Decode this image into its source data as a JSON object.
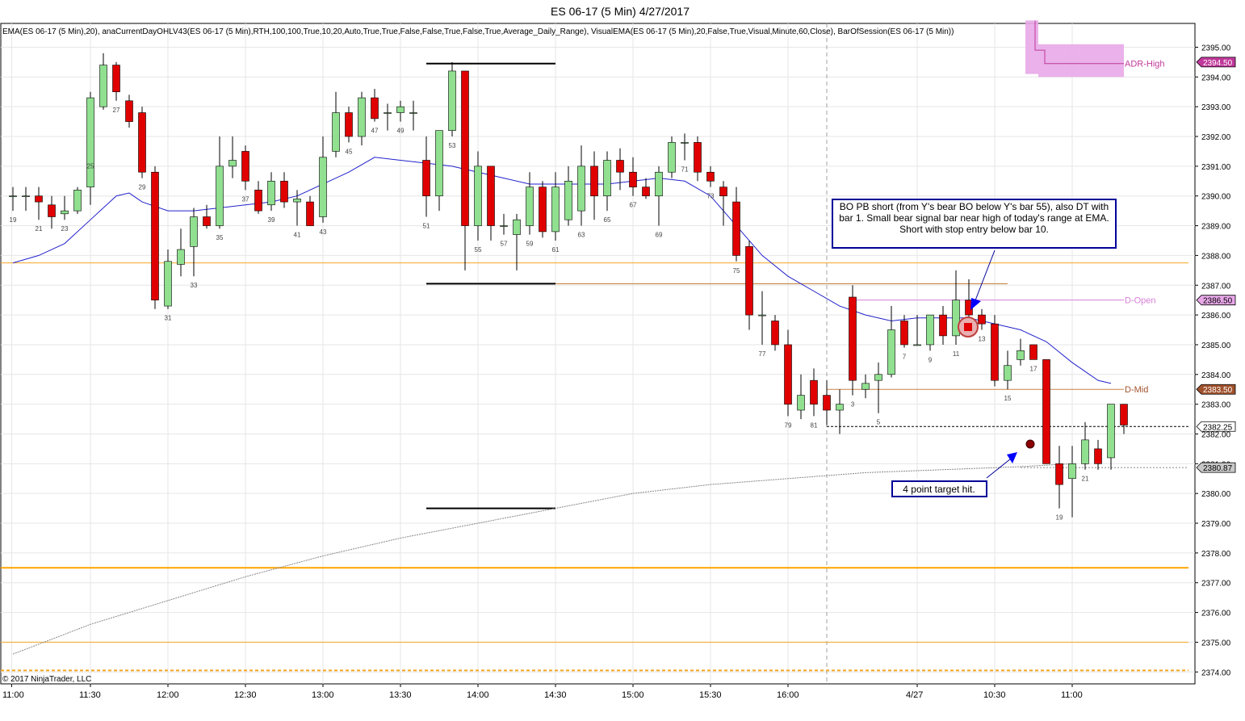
{
  "chart_data": {
    "type": "candlestick",
    "title": "ES 06-17 (5 Min)  4/27/2017",
    "indicator_label": "EMA(ES 06-17 (5 Min),20), anaCurrentDayOHLV43(ES 06-17 (5 Min),RTH,100,100,True,10,20,Auto,True,True,False,False,True,False,True,Average_Daily_Range), VisualEMA(ES 06-17 (5 Min),20,False,True,Visual,Minute,60,Close), BarOfSession(ES 06-17 (5 Min))",
    "copyright": "© 2017 NinjaTrader, LLC",
    "ylim": [
      2373.6,
      2395.8
    ],
    "y_ticks": [
      "2395.00",
      "2394.00",
      "2393.00",
      "2392.00",
      "2391.00",
      "2390.00",
      "2389.00",
      "2388.00",
      "2387.00",
      "2386.00",
      "2385.00",
      "2384.00",
      "2383.00",
      "2382.00",
      "2381.00",
      "2380.00",
      "2379.00",
      "2378.00",
      "2377.00",
      "2376.00",
      "2375.00",
      "2374.00"
    ],
    "x_ticks": [
      {
        "bar": -0.1,
        "label": "11:00"
      },
      {
        "bar": 6,
        "label": "11:30"
      },
      {
        "bar": 12,
        "label": "12:00"
      },
      {
        "bar": 18,
        "label": "12:30"
      },
      {
        "bar": 24,
        "label": "13:00"
      },
      {
        "bar": 30,
        "label": "13:30"
      },
      {
        "bar": 36,
        "label": "14:00"
      },
      {
        "bar": 42,
        "label": "14:30"
      },
      {
        "bar": 48,
        "label": "15:00"
      },
      {
        "bar": 54,
        "label": "15:30"
      },
      {
        "bar": 60,
        "label": "16:00"
      },
      {
        "bar": 70,
        "label": "4/27"
      },
      {
        "bar": 76,
        "label": "10:30"
      },
      {
        "bar": 82,
        "label": "11:00"
      }
    ],
    "session_break_bar": 63,
    "bars": [
      {
        "o": 2390.0,
        "h": 2390.3,
        "l": 2389.5,
        "c": 2390.0
      },
      {
        "o": 2390.0,
        "h": 2390.3,
        "l": 2389.5,
        "c": 2390.0
      },
      {
        "o": 2390.0,
        "h": 2390.3,
        "l": 2389.2,
        "c": 2389.8
      },
      {
        "o": 2389.7,
        "h": 2390.0,
        "l": 2388.9,
        "c": 2389.3
      },
      {
        "o": 2389.4,
        "h": 2390.0,
        "l": 2389.2,
        "c": 2389.5
      },
      {
        "o": 2389.5,
        "h": 2390.3,
        "l": 2389.4,
        "c": 2390.2
      },
      {
        "o": 2390.3,
        "h": 2393.5,
        "l": 2389.7,
        "c": 2393.3
      },
      {
        "o": 2393.0,
        "h": 2394.8,
        "l": 2392.9,
        "c": 2394.4
      },
      {
        "o": 2394.4,
        "h": 2394.5,
        "l": 2393.2,
        "c": 2393.5
      },
      {
        "o": 2393.2,
        "h": 2393.4,
        "l": 2392.3,
        "c": 2392.5
      },
      {
        "o": 2392.8,
        "h": 2393.0,
        "l": 2390.6,
        "c": 2390.8
      },
      {
        "o": 2390.8,
        "h": 2391.0,
        "l": 2386.2,
        "c": 2386.5
      },
      {
        "o": 2386.3,
        "h": 2388.2,
        "l": 2386.2,
        "c": 2387.8
      },
      {
        "o": 2387.7,
        "h": 2388.9,
        "l": 2387.3,
        "c": 2388.2
      },
      {
        "o": 2388.3,
        "h": 2389.6,
        "l": 2387.3,
        "c": 2389.3
      },
      {
        "o": 2389.3,
        "h": 2389.7,
        "l": 2388.9,
        "c": 2389.0
      },
      {
        "o": 2389.0,
        "h": 2392.0,
        "l": 2388.9,
        "c": 2391.0
      },
      {
        "o": 2391.0,
        "h": 2392.0,
        "l": 2390.6,
        "c": 2391.2
      },
      {
        "o": 2391.5,
        "h": 2391.7,
        "l": 2390.2,
        "c": 2390.5
      },
      {
        "o": 2390.2,
        "h": 2390.5,
        "l": 2389.4,
        "c": 2389.5
      },
      {
        "o": 2389.7,
        "h": 2390.8,
        "l": 2389.5,
        "c": 2390.5
      },
      {
        "o": 2390.5,
        "h": 2390.8,
        "l": 2389.6,
        "c": 2389.8
      },
      {
        "o": 2389.8,
        "h": 2390.2,
        "l": 2389.0,
        "c": 2389.9
      },
      {
        "o": 2389.8,
        "h": 2390.0,
        "l": 2389.0,
        "c": 2389.0
      },
      {
        "o": 2389.3,
        "h": 2392.0,
        "l": 2389.1,
        "c": 2391.3
      },
      {
        "o": 2391.5,
        "h": 2393.5,
        "l": 2391.3,
        "c": 2392.8
      },
      {
        "o": 2392.8,
        "h": 2393.0,
        "l": 2391.8,
        "c": 2392.0
      },
      {
        "o": 2392.0,
        "h": 2393.5,
        "l": 2391.7,
        "c": 2393.3
      },
      {
        "o": 2393.3,
        "h": 2393.6,
        "l": 2392.5,
        "c": 2392.6
      },
      {
        "o": 2392.8,
        "h": 2393.1,
        "l": 2392.2,
        "c": 2392.8
      },
      {
        "o": 2392.8,
        "h": 2393.2,
        "l": 2392.5,
        "c": 2393.0
      },
      {
        "o": 2392.8,
        "h": 2393.2,
        "l": 2392.2,
        "c": 2392.8
      },
      {
        "o": 2391.2,
        "h": 2392.0,
        "l": 2389.3,
        "c": 2390.0
      },
      {
        "o": 2390.0,
        "h": 2392.0,
        "l": 2389.5,
        "c": 2392.2
      },
      {
        "o": 2392.2,
        "h": 2394.5,
        "l": 2392.0,
        "c": 2394.2
      },
      {
        "o": 2394.2,
        "h": 2394.2,
        "l": 2387.5,
        "c": 2389.0
      },
      {
        "o": 2389.0,
        "h": 2391.5,
        "l": 2388.5,
        "c": 2391.0
      },
      {
        "o": 2391.0,
        "h": 2391.0,
        "l": 2388.5,
        "c": 2389.0
      },
      {
        "o": 2389.0,
        "h": 2389.4,
        "l": 2388.7,
        "c": 2389.0
      },
      {
        "o": 2388.7,
        "h": 2389.4,
        "l": 2387.5,
        "c": 2389.2
      },
      {
        "o": 2389.0,
        "h": 2390.8,
        "l": 2388.7,
        "c": 2390.3
      },
      {
        "o": 2390.3,
        "h": 2390.5,
        "l": 2388.6,
        "c": 2388.8
      },
      {
        "o": 2388.8,
        "h": 2390.8,
        "l": 2388.5,
        "c": 2390.3
      },
      {
        "o": 2389.2,
        "h": 2391.0,
        "l": 2389.0,
        "c": 2390.5
      },
      {
        "o": 2389.5,
        "h": 2391.7,
        "l": 2389.0,
        "c": 2391.0
      },
      {
        "o": 2391.0,
        "h": 2391.5,
        "l": 2389.2,
        "c": 2390.0
      },
      {
        "o": 2390.0,
        "h": 2391.5,
        "l": 2389.5,
        "c": 2391.2
      },
      {
        "o": 2391.2,
        "h": 2391.6,
        "l": 2390.2,
        "c": 2390.8
      },
      {
        "o": 2390.8,
        "h": 2391.3,
        "l": 2390.0,
        "c": 2390.3
      },
      {
        "o": 2390.3,
        "h": 2390.6,
        "l": 2389.9,
        "c": 2390.0
      },
      {
        "o": 2390.0,
        "h": 2391.0,
        "l": 2389.0,
        "c": 2390.8
      },
      {
        "o": 2390.8,
        "h": 2392.0,
        "l": 2390.6,
        "c": 2391.8
      },
      {
        "o": 2391.8,
        "h": 2392.1,
        "l": 2391.2,
        "c": 2391.8
      },
      {
        "o": 2391.8,
        "h": 2392.0,
        "l": 2390.5,
        "c": 2390.8
      },
      {
        "o": 2390.8,
        "h": 2391.0,
        "l": 2390.3,
        "c": 2390.5
      },
      {
        "o": 2390.3,
        "h": 2390.5,
        "l": 2389.0,
        "c": 2390.0
      },
      {
        "o": 2389.8,
        "h": 2390.3,
        "l": 2387.8,
        "c": 2388.0
      },
      {
        "o": 2388.3,
        "h": 2388.5,
        "l": 2385.5,
        "c": 2386.0
      },
      {
        "o": 2386.0,
        "h": 2386.8,
        "l": 2385.0,
        "c": 2386.0
      },
      {
        "o": 2385.8,
        "h": 2386.0,
        "l": 2384.8,
        "c": 2385.0
      },
      {
        "o": 2385.0,
        "h": 2385.5,
        "l": 2382.6,
        "c": 2383.0
      },
      {
        "o": 2382.8,
        "h": 2384.0,
        "l": 2382.5,
        "c": 2383.3
      },
      {
        "o": 2383.8,
        "h": 2384.2,
        "l": 2382.6,
        "c": 2383.0
      },
      {
        "o": 2383.3,
        "h": 2383.8,
        "l": 2382.3,
        "c": 2382.8
      },
      {
        "o": 2382.8,
        "h": 2383.5,
        "l": 2382.0,
        "c": 2383.0
      },
      {
        "o": 2386.6,
        "h": 2387.0,
        "l": 2383.3,
        "c": 2383.8
      },
      {
        "o": 2383.5,
        "h": 2384.0,
        "l": 2383.2,
        "c": 2383.7
      },
      {
        "o": 2383.8,
        "h": 2384.4,
        "l": 2382.7,
        "c": 2384.0
      },
      {
        "o": 2384.0,
        "h": 2386.3,
        "l": 2383.9,
        "c": 2385.5
      },
      {
        "o": 2385.8,
        "h": 2386.0,
        "l": 2384.9,
        "c": 2385.0
      },
      {
        "o": 2385.0,
        "h": 2386.0,
        "l": 2385.0,
        "c": 2385.0
      },
      {
        "o": 2385.0,
        "h": 2386.0,
        "l": 2384.8,
        "c": 2386.0
      },
      {
        "o": 2386.0,
        "h": 2386.3,
        "l": 2385.0,
        "c": 2385.3
      },
      {
        "o": 2385.3,
        "h": 2387.5,
        "l": 2385.0,
        "c": 2386.5
      },
      {
        "o": 2386.5,
        "h": 2387.2,
        "l": 2385.8,
        "c": 2386.0
      },
      {
        "o": 2386.0,
        "h": 2386.2,
        "l": 2385.5,
        "c": 2385.7
      },
      {
        "o": 2385.7,
        "h": 2386.0,
        "l": 2383.6,
        "c": 2383.8
      },
      {
        "o": 2383.8,
        "h": 2384.8,
        "l": 2383.5,
        "c": 2384.3
      },
      {
        "o": 2384.5,
        "h": 2385.2,
        "l": 2384.3,
        "c": 2384.8
      },
      {
        "o": 2385.0,
        "h": 2385.0,
        "l": 2384.5,
        "c": 2384.5
      },
      {
        "o": 2384.5,
        "h": 2384.5,
        "l": 2381.0,
        "c": 2381.0
      },
      {
        "o": 2381.0,
        "h": 2381.6,
        "l": 2379.5,
        "c": 2380.3
      },
      {
        "o": 2380.5,
        "h": 2381.6,
        "l": 2379.2,
        "c": 2381.0
      },
      {
        "o": 2381.0,
        "h": 2382.4,
        "l": 2380.8,
        "c": 2381.8
      },
      {
        "o": 2381.5,
        "h": 2381.8,
        "l": 2380.8,
        "c": 2381.0
      },
      {
        "o": 2381.2,
        "h": 2383.0,
        "l": 2380.8,
        "c": 2383.0
      },
      {
        "o": 2383.0,
        "h": 2383.0,
        "l": 2382.0,
        "c": 2382.3
      }
    ],
    "bar_labels": [
      {
        "bar": 0,
        "text": "19",
        "at": "low"
      },
      {
        "bar": 2,
        "text": "21",
        "at": "low"
      },
      {
        "bar": 4,
        "text": "23",
        "at": "low"
      },
      {
        "bar": 6,
        "text": "25",
        "at": "high"
      },
      {
        "bar": 8,
        "text": "27",
        "at": "low"
      },
      {
        "bar": 10,
        "text": "29",
        "at": "low"
      },
      {
        "bar": 12,
        "text": "31",
        "at": "low"
      },
      {
        "bar": 14,
        "text": "33",
        "at": "low"
      },
      {
        "bar": 16,
        "text": "35",
        "at": "low"
      },
      {
        "bar": 18,
        "text": "37",
        "at": "low"
      },
      {
        "bar": 20,
        "text": "39",
        "at": "low"
      },
      {
        "bar": 22,
        "text": "41",
        "at": "low"
      },
      {
        "bar": 24,
        "text": "43",
        "at": "low"
      },
      {
        "bar": 26,
        "text": "45",
        "at": "low"
      },
      {
        "bar": 28,
        "text": "47",
        "at": "low"
      },
      {
        "bar": 30,
        "text": "49",
        "at": "low"
      },
      {
        "bar": 32,
        "text": "51",
        "at": "low"
      },
      {
        "bar": 34,
        "text": "53",
        "at": "low"
      },
      {
        "bar": 36,
        "text": "55",
        "at": "low"
      },
      {
        "bar": 38,
        "text": "57",
        "at": "low"
      },
      {
        "bar": 40,
        "text": "59",
        "at": "low"
      },
      {
        "bar": 42,
        "text": "61",
        "at": "low"
      },
      {
        "bar": 44,
        "text": "63",
        "at": "low"
      },
      {
        "bar": 46,
        "text": "65",
        "at": "low"
      },
      {
        "bar": 48,
        "text": "67",
        "at": "low"
      },
      {
        "bar": 50,
        "text": "69",
        "at": "low"
      },
      {
        "bar": 52,
        "text": "71",
        "at": "low"
      },
      {
        "bar": 54,
        "text": "73",
        "at": "low"
      },
      {
        "bar": 56,
        "text": "75",
        "at": "low"
      },
      {
        "bar": 58,
        "text": "77",
        "at": "low"
      },
      {
        "bar": 60,
        "text": "79",
        "at": "low"
      },
      {
        "bar": 62,
        "text": "81",
        "at": "low"
      },
      {
        "bar": 65,
        "text": "3",
        "at": "low"
      },
      {
        "bar": 67,
        "text": "5",
        "at": "low"
      },
      {
        "bar": 69,
        "text": "7",
        "at": "low"
      },
      {
        "bar": 71,
        "text": "9",
        "at": "low"
      },
      {
        "bar": 73,
        "text": "11",
        "at": "low"
      },
      {
        "bar": 75,
        "text": "13",
        "at": "low"
      },
      {
        "bar": 77,
        "text": "15",
        "at": "low"
      },
      {
        "bar": 79,
        "text": "17",
        "at": "low"
      },
      {
        "bar": 81,
        "text": "19",
        "at": "low"
      },
      {
        "bar": 83,
        "text": "21",
        "at": "low"
      }
    ],
    "ema": [
      [
        0,
        2387.75
      ],
      [
        2,
        2388.0
      ],
      [
        4,
        2388.4
      ],
      [
        6,
        2389.2
      ],
      [
        8,
        2390.0
      ],
      [
        9,
        2390.1
      ],
      [
        10,
        2389.8
      ],
      [
        12,
        2389.5
      ],
      [
        14,
        2389.5
      ],
      [
        16,
        2389.6
      ],
      [
        18,
        2389.7
      ],
      [
        20,
        2389.8
      ],
      [
        22,
        2390.0
      ],
      [
        24,
        2390.4
      ],
      [
        26,
        2390.8
      ],
      [
        28,
        2391.3
      ],
      [
        30,
        2391.2
      ],
      [
        32,
        2391.1
      ],
      [
        34,
        2391.0
      ],
      [
        36,
        2390.8
      ],
      [
        38,
        2390.6
      ],
      [
        40,
        2390.4
      ],
      [
        42,
        2390.4
      ],
      [
        44,
        2390.4
      ],
      [
        46,
        2390.4
      ],
      [
        48,
        2390.5
      ],
      [
        50,
        2390.6
      ],
      [
        52,
        2390.5
      ],
      [
        54,
        2390.0
      ],
      [
        56,
        2389.0
      ],
      [
        58,
        2388.0
      ],
      [
        60,
        2387.3
      ],
      [
        62,
        2386.8
      ],
      [
        64,
        2386.3
      ],
      [
        66,
        2386.0
      ],
      [
        68,
        2385.8
      ],
      [
        70,
        2385.9
      ],
      [
        72,
        2385.9
      ],
      [
        74,
        2385.9
      ],
      [
        76,
        2385.7
      ],
      [
        78,
        2385.5
      ],
      [
        80,
        2385.1
      ],
      [
        82,
        2384.4
      ],
      [
        84,
        2383.8
      ],
      [
        85,
        2383.7
      ]
    ],
    "visual_ema": [
      [
        0,
        2374.6
      ],
      [
        6,
        2375.6
      ],
      [
        12,
        2376.4
      ],
      [
        18,
        2377.2
      ],
      [
        24,
        2377.9
      ],
      [
        30,
        2378.5
      ],
      [
        36,
        2379.0
      ],
      [
        42,
        2379.5
      ],
      [
        48,
        2380.0
      ],
      [
        54,
        2380.3
      ],
      [
        60,
        2380.5
      ],
      [
        66,
        2380.7
      ],
      [
        72,
        2380.8
      ],
      [
        78,
        2380.9
      ],
      [
        82,
        2381.0
      ]
    ],
    "levels": [
      {
        "name": "orange-upper",
        "y": 2387.75,
        "from": 0,
        "to": 91,
        "color": "#f5a623",
        "width": 1
      },
      {
        "name": "orange-thick",
        "y": 2377.5,
        "from": 0,
        "to": 91,
        "color": "#ffa500",
        "width": 2
      },
      {
        "name": "orange-thin",
        "y": 2375.0,
        "from": 0,
        "to": 91,
        "color": "#f5a623",
        "width": 1
      },
      {
        "name": "orange-dashed",
        "y": 2374.05,
        "from": 0,
        "to": 91,
        "color": "#f5a623",
        "width": 2,
        "dash": "4,3"
      },
      {
        "name": "d-open-line",
        "y": 2386.5,
        "from": 65,
        "to": 86,
        "color": "#d87fd8",
        "width": 1
      },
      {
        "name": "d-mid-line",
        "y": 2383.5,
        "from": 63,
        "to": 86,
        "color": "#c8824a",
        "width": 1
      },
      {
        "name": "prev-low-line",
        "y": 2387.05,
        "from": 36,
        "to": 77,
        "color": "#c0782c",
        "width": 1
      },
      {
        "name": "close-dashed",
        "y": 2382.25,
        "from": 63,
        "to": 91,
        "color": "#000000",
        "width": 1,
        "dash": "3,2"
      },
      {
        "name": "gray-dotted",
        "y": 2380.87,
        "from": 78,
        "to": 91,
        "color": "#888888",
        "width": 1,
        "dash": "2,2"
      }
    ],
    "black_segments": [
      {
        "y": 2394.45,
        "from": 32,
        "to": 42
      },
      {
        "y": 2387.05,
        "from": 32,
        "to": 42
      },
      {
        "y": 2379.5,
        "from": 32,
        "to": 42
      }
    ],
    "level_labels": [
      {
        "text": "ADR-High",
        "y": 2394.45,
        "color": "#c0389a"
      },
      {
        "text": "D-Open",
        "y": 2386.5,
        "color": "#d87fd8"
      },
      {
        "text": "D-Mid",
        "y": 2383.5,
        "color": "#a0522d"
      }
    ],
    "price_badges": [
      {
        "text": "2394.50",
        "y": 2394.5,
        "bg": "#c0389a",
        "fg": "#ffffff"
      },
      {
        "text": "2386.50",
        "y": 2386.5,
        "bg": "#e8a8e8",
        "fg": "#000000"
      },
      {
        "text": "2383.50",
        "y": 2383.5,
        "bg": "#a0522d",
        "fg": "#ffffff"
      },
      {
        "text": "2382.25",
        "y": 2382.25,
        "bg": "#ffffff",
        "fg": "#000000"
      },
      {
        "text": "2380.87",
        "y": 2380.87,
        "bg": "#c8c8c8",
        "fg": "#000000"
      }
    ],
    "adr_zone": {
      "top": 2395.9,
      "bottom": 2394.1,
      "bar_from": 79,
      "bar_to": 85,
      "color": "#e8a8e8"
    },
    "annotations": [
      {
        "text": "BO PB short (from Y's bear BO below Y's bar 55), also DT with bar 1.  Small bear signal bar near high of today's range at EMA.  Short with stop entry below bar 10."
      },
      {
        "text": "4 point target hit."
      }
    ],
    "colors": {
      "up": "#90e090",
      "down": "#e00000",
      "ema": "#2222cc",
      "visual_ema": "#888888",
      "annotation_border": "#000099",
      "arrow": "#0000ff"
    }
  }
}
